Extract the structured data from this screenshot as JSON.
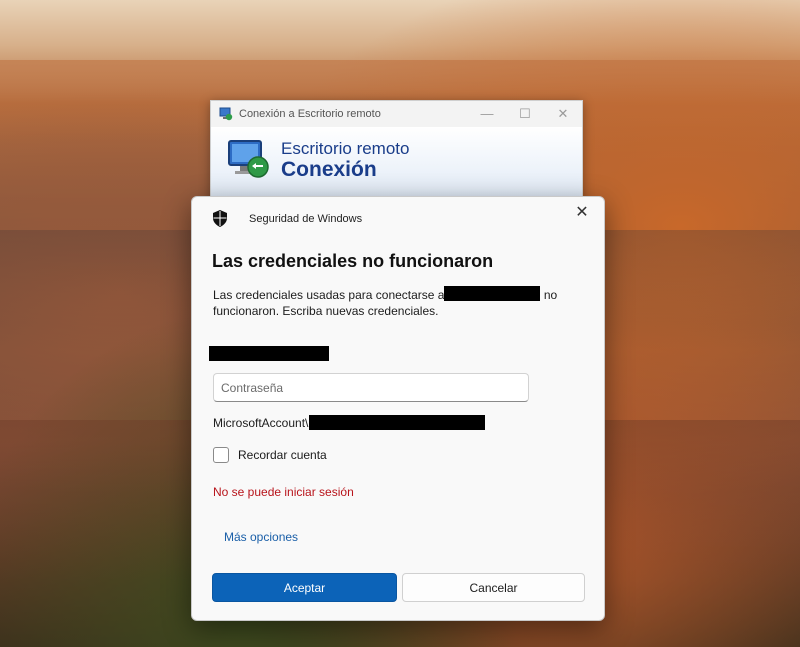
{
  "rdp_window": {
    "title": "Conexión a Escritorio remoto",
    "minimize_glyph": "—",
    "maximize_glyph": "☐",
    "close_glyph": "✕",
    "banner_line1": "Escritorio remoto",
    "banner_line2": "Conexión",
    "icon": "remote-desktop-icon"
  },
  "dialog": {
    "app_name": "Seguridad de Windows",
    "close_glyph": "✕",
    "heading": "Las credenciales no funcionaron",
    "message_before": "Las credenciales usadas para conectarse a",
    "message_after": " no funcionaron. Escriba nuevas credenciales.",
    "password_placeholder": "Contraseña",
    "account_prefix": "MicrosoftAccount\\",
    "remember_label": "Recordar cuenta",
    "remember_checked": false,
    "error_text": "No se puede iniciar sesión",
    "more_options": "Más opciones",
    "ok_label": "Aceptar",
    "cancel_label": "Cancelar"
  },
  "colors": {
    "accent": "#0c63b8",
    "error": "#b8141b",
    "link": "#1a5fa8"
  }
}
